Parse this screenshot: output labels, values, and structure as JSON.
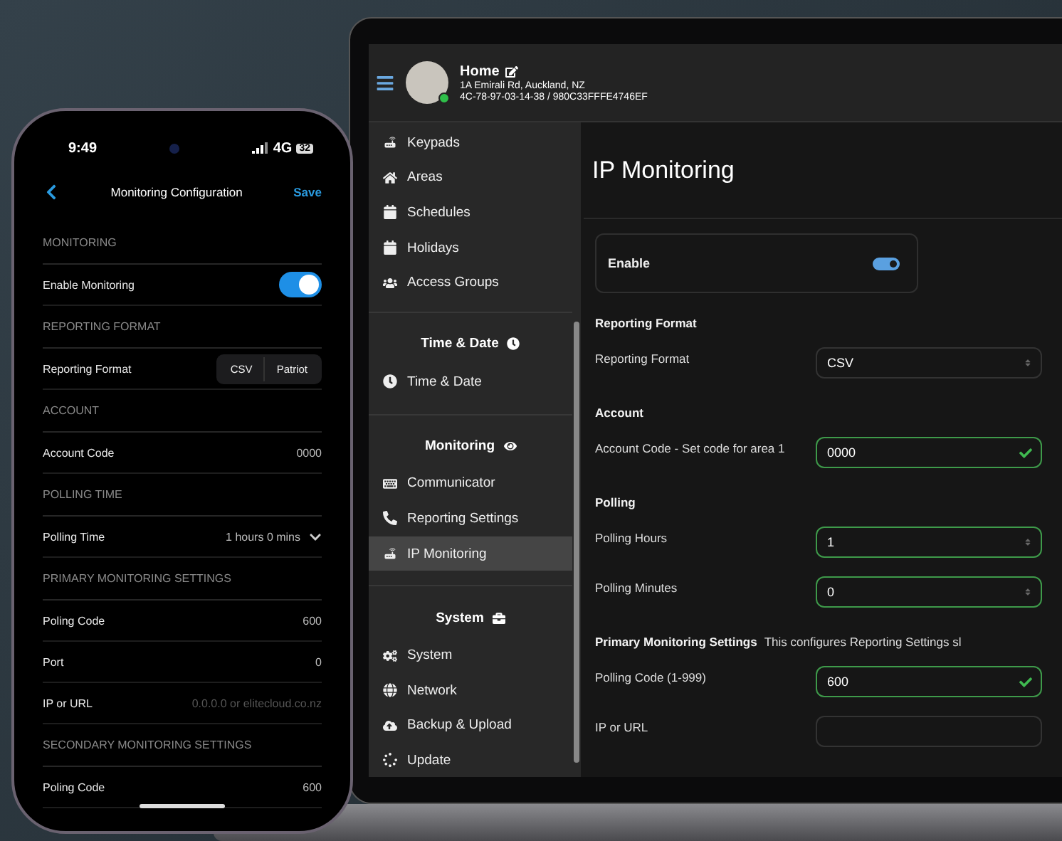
{
  "laptop": {
    "header": {
      "title": "Home",
      "address": "1A Emirali Rd, Auckland, NZ",
      "ids": "4C-78-97-03-14-38 / 980C33FFFE4746EF",
      "online": true
    },
    "sidebar": {
      "groups": [
        {
          "items": [
            {
              "label": "Keypads",
              "selected": false
            },
            {
              "label": "Areas",
              "selected": false
            },
            {
              "label": "Schedules",
              "selected": false
            },
            {
              "label": "Holidays",
              "selected": false
            },
            {
              "label": "Access Groups",
              "selected": false
            }
          ]
        },
        {
          "title": "Time & Date",
          "items": [
            {
              "label": "Time & Date",
              "selected": false
            }
          ]
        },
        {
          "title": "Monitoring",
          "items": [
            {
              "label": "Communicator",
              "selected": false
            },
            {
              "label": "Reporting Settings",
              "selected": false
            },
            {
              "label": "IP Monitoring",
              "selected": true
            }
          ]
        },
        {
          "title": "System",
          "items": [
            {
              "label": "System",
              "selected": false
            },
            {
              "label": "Network",
              "selected": false
            },
            {
              "label": "Backup & Upload",
              "selected": false
            },
            {
              "label": "Update",
              "selected": false
            }
          ]
        }
      ]
    },
    "main": {
      "title": "IP Monitoring",
      "enable": {
        "label": "Enable",
        "on": true
      },
      "sections": [
        {
          "title": "Reporting Format",
          "fields": [
            {
              "label": "Reporting Format",
              "kind": "select",
              "value": "CSV",
              "valid": false
            }
          ]
        },
        {
          "title": "Account",
          "fields": [
            {
              "label": "Account Code - Set code for area 1",
              "kind": "text",
              "value": "0000",
              "valid": true
            }
          ]
        },
        {
          "title": "Polling",
          "fields": [
            {
              "label": "Polling Hours",
              "kind": "number",
              "value": "1",
              "valid": true
            },
            {
              "label": "Polling Minutes",
              "kind": "number",
              "value": "0",
              "valid": true
            }
          ]
        },
        {
          "title": "Primary Monitoring Settings",
          "note": "This configures Reporting Settings sl",
          "fields": [
            {
              "label": "Polling Code (1-999)",
              "kind": "text",
              "value": "600",
              "valid": true
            },
            {
              "label": "IP or URL",
              "kind": "text",
              "valid": false
            }
          ]
        }
      ]
    }
  },
  "phone": {
    "status": {
      "time": "9:49",
      "network": "4G",
      "battery": "32"
    },
    "nav": {
      "title": "Monitoring Configuration",
      "action": "Save"
    },
    "sections": [
      {
        "header": "MONITORING",
        "rows": [
          {
            "label": "Enable Monitoring",
            "kind": "switch",
            "on": true
          }
        ]
      },
      {
        "header": "REPORTING FORMAT",
        "rows": [
          {
            "label": "Reporting Format",
            "kind": "segments",
            "options": [
              "CSV",
              "Patriot"
            ]
          }
        ]
      },
      {
        "header": "ACCOUNT",
        "rows": [
          {
            "label": "Account Code",
            "kind": "value",
            "value": "0000"
          }
        ]
      },
      {
        "header": "POLLING TIME",
        "rows": [
          {
            "label": "Polling Time",
            "kind": "dropdown",
            "value": "1 hours 0 mins"
          }
        ]
      },
      {
        "header": "PRIMARY MONITORING SETTINGS",
        "rows": [
          {
            "label": "Poling Code",
            "kind": "value",
            "value": "600"
          },
          {
            "label": "Port",
            "kind": "value",
            "value": "0"
          },
          {
            "label": "IP or URL",
            "kind": "placeholder",
            "value": "0.0.0.0 or elitecloud.co.nz"
          }
        ]
      },
      {
        "header": "SECONDARY MONITORING SETTINGS",
        "rows": [
          {
            "label": "Poling Code",
            "kind": "value",
            "value": "600"
          }
        ]
      }
    ]
  }
}
